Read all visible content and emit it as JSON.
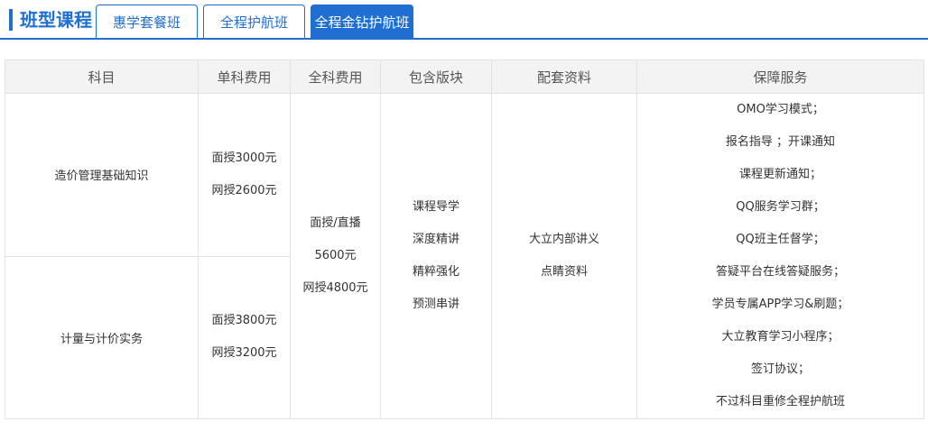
{
  "header": {
    "title": "班型课程",
    "tabs": [
      {
        "label": "惠学套餐班",
        "active": false
      },
      {
        "label": "全程护航班",
        "active": false
      },
      {
        "label": "全程金钻护航班",
        "active": true
      }
    ]
  },
  "table": {
    "columns": [
      "科目",
      "单科费用",
      "全科费用",
      "包含版块",
      "配套资料",
      "保障服务"
    ],
    "subjects": [
      {
        "name": "造价管理基础知识",
        "fees": [
          "面授3000元",
          "网授2600元"
        ]
      },
      {
        "name": "计量与计价实务",
        "fees": [
          "面授3800元",
          "网授3200元"
        ]
      }
    ],
    "all_fee": [
      "面授/直播",
      "5600元",
      "网授4800元"
    ],
    "modules": [
      "课程导学",
      "深度精讲",
      "精粹强化",
      "预测串讲"
    ],
    "materials": [
      "大立内部讲义",
      "点睛资料"
    ],
    "services": [
      "OMO学习模式；",
      "报名指导 ；开课通知",
      "课程更新通知；",
      "QQ服务学习群；",
      "QQ班主任督学；",
      "答疑平台在线答疑服务；",
      "学员专属APP学习&刷题；",
      "大立教育学习小程序；",
      "签订协议；",
      "不过科目重修全程护航班"
    ]
  },
  "colors": {
    "accent": "#1e6fd0",
    "header_bg": "#f3f3f3",
    "border": "#e2e2e2"
  }
}
